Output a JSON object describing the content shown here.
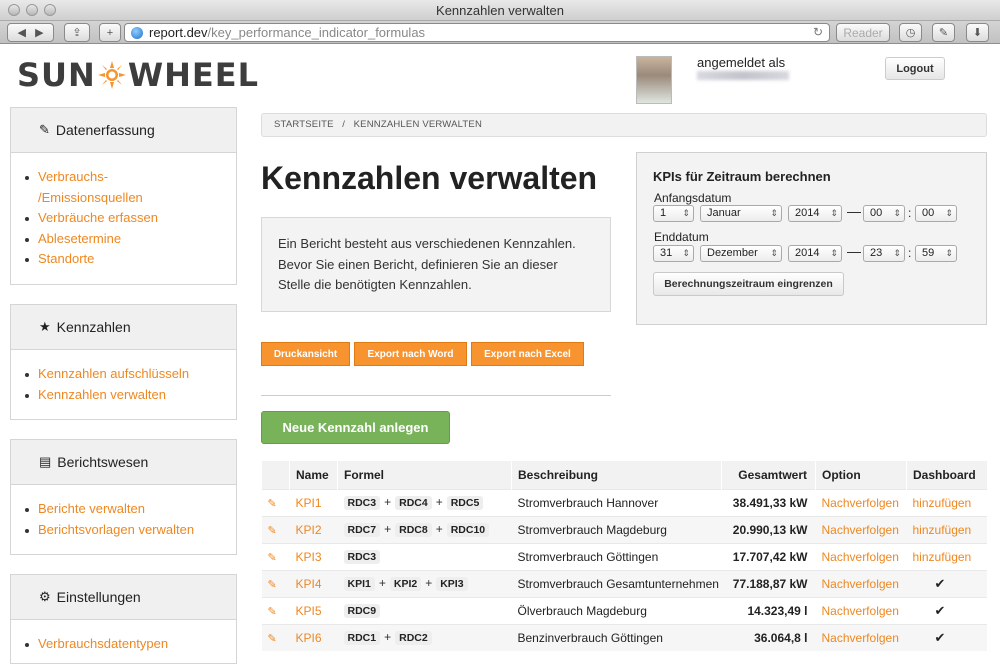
{
  "window": {
    "title": "Kennzahlen verwalten"
  },
  "browser": {
    "url_host": "report.dev",
    "url_path": "/key_performance_indicator_formulas",
    "reader_label": "Reader"
  },
  "brand": {
    "logo_left": "SUN",
    "logo_right": "WHEEL",
    "accent": "#f7942f"
  },
  "user": {
    "logged_in_label": "angemeldet als",
    "logout_label": "Logout"
  },
  "sidebar": {
    "sections": [
      {
        "title": "Datenerfassung",
        "icon": "edit-icon",
        "items": [
          "Verbrauchs-",
          "/Emissionsquellen",
          "Verbräuche erfassen",
          "Ablesetermine",
          "Standorte"
        ]
      },
      {
        "title": "Kennzahlen",
        "icon": "star-icon",
        "items": [
          "Kennzahlen aufschlüsseln",
          "Kennzahlen verwalten"
        ]
      },
      {
        "title": "Berichtswesen",
        "icon": "chart-icon",
        "items": [
          "Berichte verwalten",
          "Berichtsvorlagen verwalten"
        ]
      },
      {
        "title": "Einstellungen",
        "icon": "gear-icon",
        "items": [
          "Verbrauchsdatentypen"
        ]
      }
    ]
  },
  "breadcrumb": {
    "home": "STARTSEITE",
    "sep": "/",
    "current": "KENNZAHLEN VERWALTEN"
  },
  "main": {
    "title": "Kennzahlen verwalten",
    "info_lines": [
      "Ein Bericht besteht aus verschiedenen Kennzahlen.",
      "Bevor Sie einen Bericht, definieren Sie an dieser",
      "Stelle die benötigten Kennzahlen."
    ],
    "buttons": {
      "print": "Druckansicht",
      "word": "Export nach Word",
      "excel": "Export nach Excel",
      "new_kpi": "Neue Kennzahl anlegen"
    }
  },
  "kpi_period": {
    "title": "KPIs für Zeitraum berechnen",
    "start_label": "Anfangsdatum",
    "start": {
      "day": "1",
      "month": "Januar",
      "year": "2014",
      "hour": "00",
      "minute": "00"
    },
    "end_label": "Enddatum",
    "end": {
      "day": "31",
      "month": "Dezember",
      "year": "2014",
      "hour": "23",
      "minute": "59"
    },
    "button": "Berechnungszeitraum eingrenzen"
  },
  "table": {
    "headers": {
      "name": "Name",
      "formula": "Formel",
      "description": "Beschreibung",
      "total": "Gesamtwert",
      "option": "Option",
      "dashboard": "Dashboard"
    },
    "plus": "+",
    "follow": "Nachverfolgen",
    "add": "hinzufügen",
    "check": "✔",
    "rows": [
      {
        "name": "KPI1",
        "formula": [
          "RDC3",
          "RDC4",
          "RDC5"
        ],
        "description": "Stromverbrauch Hannover",
        "total": "38.491,33 kW",
        "dashboard": "add"
      },
      {
        "name": "KPI2",
        "formula": [
          "RDC7",
          "RDC8",
          "RDC10"
        ],
        "description": "Stromverbrauch Magdeburg",
        "total": "20.990,13 kW",
        "dashboard": "add"
      },
      {
        "name": "KPI3",
        "formula": [
          "RDC3"
        ],
        "description": "Stromverbrauch Göttingen",
        "total": "17.707,42 kW",
        "dashboard": "add"
      },
      {
        "name": "KPI4",
        "formula": [
          "KPI1",
          "KPI2",
          "KPI3"
        ],
        "description": "Stromverbrauch Gesamtunternehmen",
        "total": "77.188,87 kW",
        "dashboard": "check"
      },
      {
        "name": "KPI5",
        "formula": [
          "RDC9"
        ],
        "description": "Ölverbrauch Magdeburg",
        "total": "14.323,49 l",
        "dashboard": "check"
      },
      {
        "name": "KPI6",
        "formula": [
          "RDC1",
          "RDC2"
        ],
        "description": "Benzinverbrauch Göttingen",
        "total": "36.064,8 l",
        "dashboard": "check"
      }
    ]
  }
}
